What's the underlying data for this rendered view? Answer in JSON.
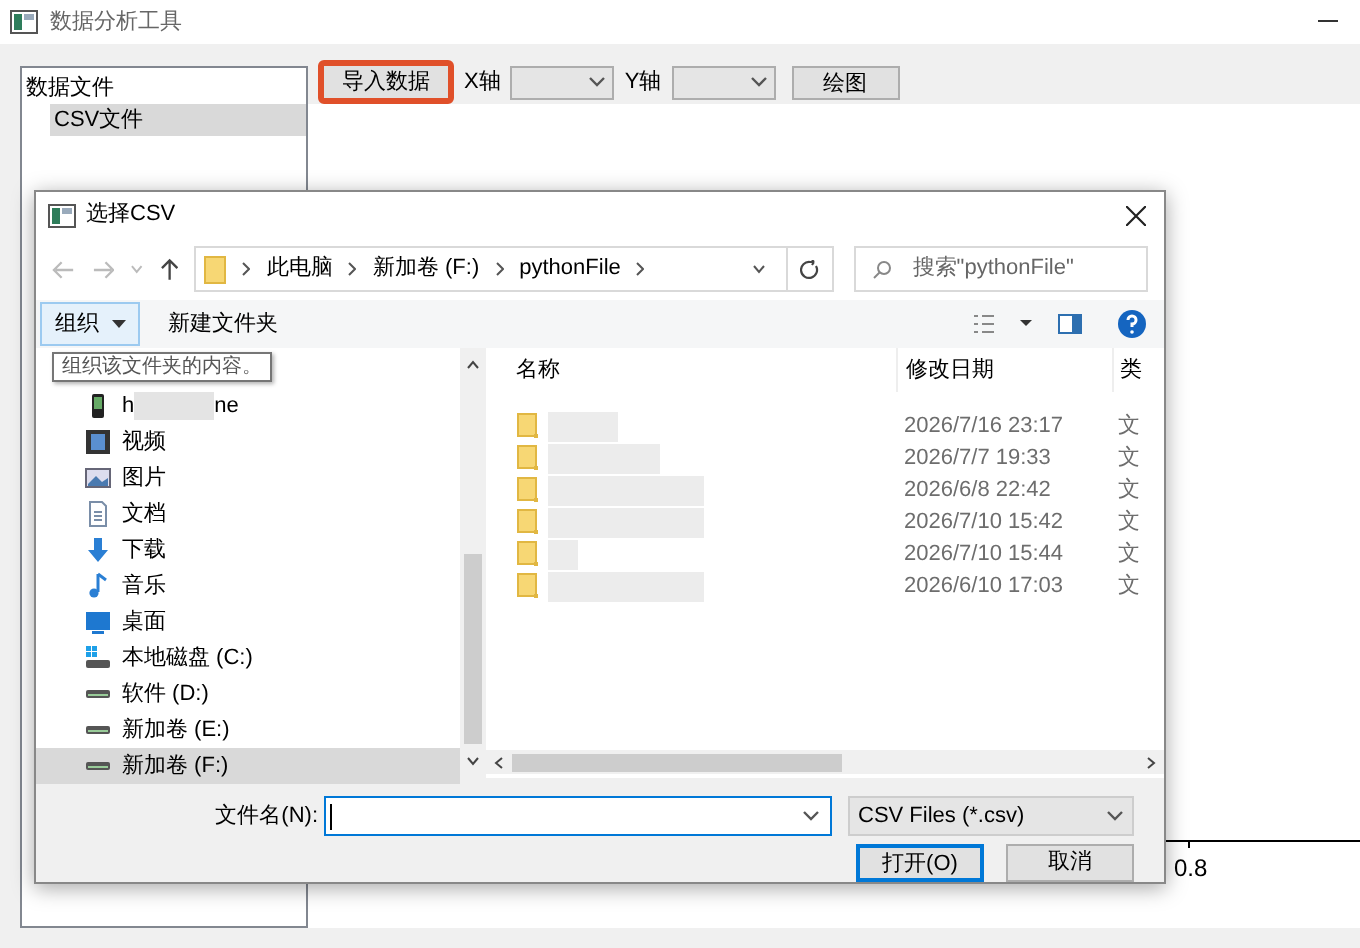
{
  "window": {
    "title": "数据分析工具"
  },
  "tree": {
    "root": "数据文件",
    "children": [
      {
        "label": "CSV文件",
        "selected": true
      }
    ]
  },
  "toolbar": {
    "import_button": "导入数据",
    "import_highlighted": true,
    "x_label": "X轴",
    "y_label": "Y轴",
    "plot_button": "绘图"
  },
  "plot": {
    "tick_label": "0.8"
  },
  "dialog": {
    "title": "选择CSV",
    "breadcrumb": [
      "此电脑",
      "新加卷 (F:)",
      "pythonFile"
    ],
    "search": {
      "placeholder": "搜索\"pythonFile\""
    },
    "organize_button": "组织",
    "new_folder_button": "新建文件夹",
    "tooltip": "组织该文件夹的内容。",
    "nav_items": [
      {
        "kind": "phone",
        "label_start": "h",
        "label_end": "ne",
        "redacted": true,
        "selected": false
      },
      {
        "kind": "video",
        "label": "视频",
        "selected": false
      },
      {
        "kind": "pictures",
        "label": "图片",
        "selected": false
      },
      {
        "kind": "documents",
        "label": "文档",
        "selected": false
      },
      {
        "kind": "downloads",
        "label": "下载",
        "selected": false
      },
      {
        "kind": "music",
        "label": "音乐",
        "selected": false
      },
      {
        "kind": "desktop",
        "label": "桌面",
        "selected": false
      },
      {
        "kind": "system-drive",
        "label": "本地磁盘 (C:)",
        "selected": false
      },
      {
        "kind": "drive",
        "label": "软件 (D:)",
        "selected": false
      },
      {
        "kind": "drive",
        "label": "新加卷 (E:)",
        "selected": false
      },
      {
        "kind": "drive",
        "label": "新加卷 (F:)",
        "selected": true
      }
    ],
    "columns": [
      "名称",
      "修改日期",
      "类"
    ],
    "rows": [
      {
        "modified": "2026/7/16 23:17",
        "type": "文"
      },
      {
        "modified": "2026/7/7 19:33",
        "type": "文"
      },
      {
        "modified": "2026/6/8 22:42",
        "type": "文"
      },
      {
        "modified": "2026/7/10 15:42",
        "type": "文"
      },
      {
        "modified": "2026/7/10 15:44",
        "type": "文"
      },
      {
        "modified": "2026/6/10 17:03",
        "type": "文"
      }
    ],
    "filename_label": "文件名(N):",
    "file_type": "CSV Files (*.csv)",
    "open_button": "打开(O)",
    "cancel_button": "取消"
  }
}
